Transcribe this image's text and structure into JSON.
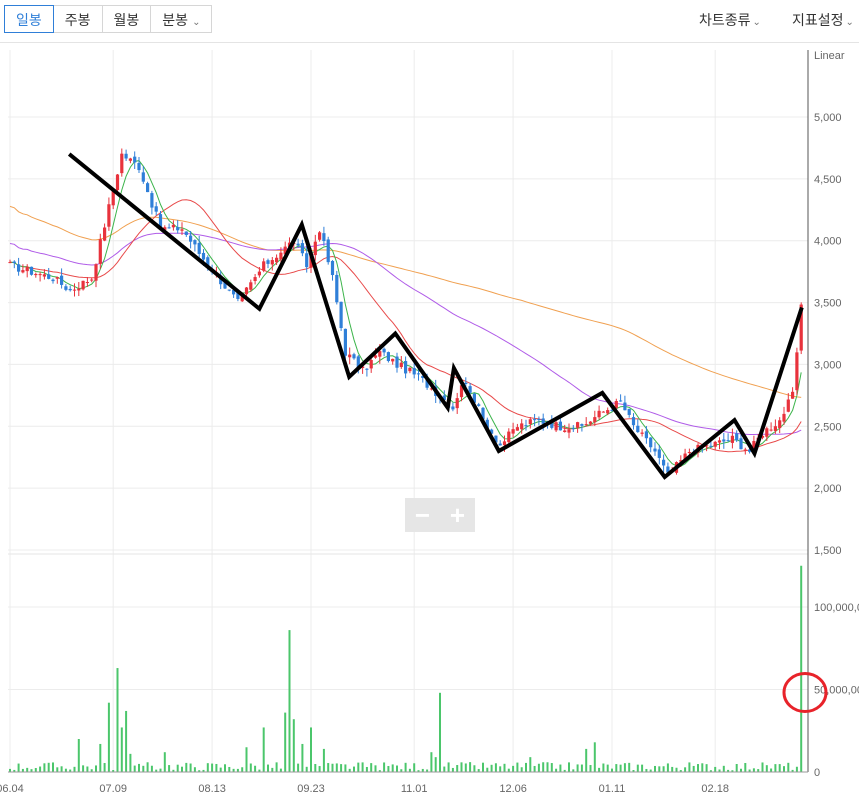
{
  "toolbar": {
    "tabs": [
      {
        "label": "일봉",
        "active": true
      },
      {
        "label": "주봉",
        "active": false
      },
      {
        "label": "월봉",
        "active": false
      },
      {
        "label": "분봉",
        "active": false,
        "dropdown": true
      }
    ],
    "chart_type_label": "차트종류",
    "indicator_label": "지표설정"
  },
  "zoom": {
    "minus": "−",
    "plus": "+"
  },
  "colors": {
    "up": "#e8323c",
    "down": "#2f7fd8",
    "ma5": "#3cb44b",
    "ma20": "#e84a4a",
    "ma60": "#b05ce8",
    "ma120": "#f0a050",
    "volume": "#4bc66b",
    "trendline": "#000000",
    "marker": "#e8232a"
  },
  "chart_data": {
    "type": "candlestick",
    "scale_label": "Linear",
    "x_ticks": [
      "06.04",
      "07.09",
      "08.13",
      "09.23",
      "11.01",
      "12.06",
      "01.11",
      "02.18"
    ],
    "price_axis": {
      "min": 1500,
      "max": 5000,
      "ticks": [
        1500,
        2000,
        2500,
        3000,
        3500,
        4000,
        4500,
        5000
      ]
    },
    "volume_axis": {
      "min": 0,
      "max": 100000000,
      "ticks": [
        "0",
        "50,000,00",
        "100,000,0"
      ]
    },
    "price_anchors": [
      [
        0,
        3800
      ],
      [
        10,
        3700
      ],
      [
        14,
        3600
      ],
      [
        19,
        3700
      ],
      [
        26,
        4700
      ],
      [
        30,
        4600
      ],
      [
        35,
        4100
      ],
      [
        40,
        4100
      ],
      [
        44,
        3900
      ],
      [
        53,
        3500
      ],
      [
        59,
        3800
      ],
      [
        66,
        4000
      ],
      [
        69,
        3800
      ],
      [
        72,
        4100
      ],
      [
        75,
        3700
      ],
      [
        78,
        3100
      ],
      [
        82,
        2950
      ],
      [
        86,
        3100
      ],
      [
        90,
        3000
      ],
      [
        95,
        2900
      ],
      [
        100,
        2750
      ],
      [
        103,
        2650
      ],
      [
        105,
        2850
      ],
      [
        107,
        2800
      ],
      [
        110,
        2550
      ],
      [
        114,
        2350
      ],
      [
        118,
        2500
      ],
      [
        123,
        2550
      ],
      [
        128,
        2500
      ],
      [
        133,
        2500
      ],
      [
        137,
        2600
      ],
      [
        142,
        2700
      ],
      [
        145,
        2500
      ],
      [
        150,
        2300
      ],
      [
        153,
        2100
      ],
      [
        158,
        2300
      ],
      [
        163,
        2350
      ],
      [
        168,
        2400
      ],
      [
        172,
        2300
      ],
      [
        175,
        2450
      ],
      [
        179,
        2550
      ],
      [
        182,
        2750
      ],
      [
        184,
        3450
      ]
    ],
    "volume_spikes": [
      [
        16,
        20000000
      ],
      [
        21,
        17000000
      ],
      [
        23,
        42000000
      ],
      [
        25,
        63000000
      ],
      [
        26,
        27000000
      ],
      [
        27,
        37000000
      ],
      [
        28,
        11000000
      ],
      [
        36,
        12000000
      ],
      [
        55,
        15000000
      ],
      [
        59,
        27000000
      ],
      [
        64,
        36000000
      ],
      [
        65,
        86000000
      ],
      [
        66,
        32000000
      ],
      [
        68,
        17000000
      ],
      [
        70,
        27000000
      ],
      [
        73,
        14000000
      ],
      [
        98,
        12000000
      ],
      [
        99,
        9000000
      ],
      [
        100,
        48000000
      ],
      [
        121,
        9000000
      ],
      [
        134,
        14000000
      ],
      [
        136,
        18000000
      ],
      [
        184,
        125000000
      ]
    ],
    "zigzag": [
      [
        4.75,
        4700
      ],
      [
        20,
        3450
      ],
      [
        23.4,
        4130
      ],
      [
        27.2,
        2900
      ],
      [
        30.9,
        3250
      ],
      [
        35.1,
        2650
      ],
      [
        35.6,
        2970
      ],
      [
        39.2,
        2300
      ],
      [
        47.5,
        2770
      ],
      [
        52.5,
        2090
      ],
      [
        58.1,
        2550
      ],
      [
        59.7,
        2280
      ],
      [
        63.5,
        3460
      ]
    ],
    "volume_marker": {
      "volume": 50000000,
      "label_ref": "50,000,00"
    }
  }
}
